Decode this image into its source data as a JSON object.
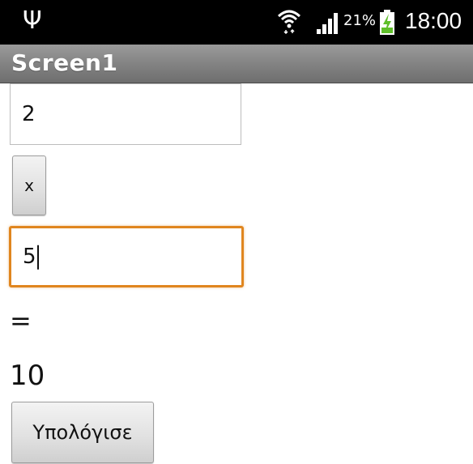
{
  "status_bar": {
    "usb_icon": "usb-icon",
    "wifi_icon": "wifi-icon",
    "signal_icon": "signal-icon",
    "battery_percent": "21%",
    "battery_icon": "battery-charging-icon",
    "time": "18:00"
  },
  "title_bar": {
    "title": "Screen1"
  },
  "form": {
    "first_value": "2",
    "operator_button": "x",
    "second_value": "5",
    "equals_label": "=",
    "result": "10",
    "calculate_button": "Υπολόγισε"
  },
  "colors": {
    "status_bar_bg": "#000000",
    "title_bar_bg": "#808080",
    "focus_border": "#e0861f"
  }
}
